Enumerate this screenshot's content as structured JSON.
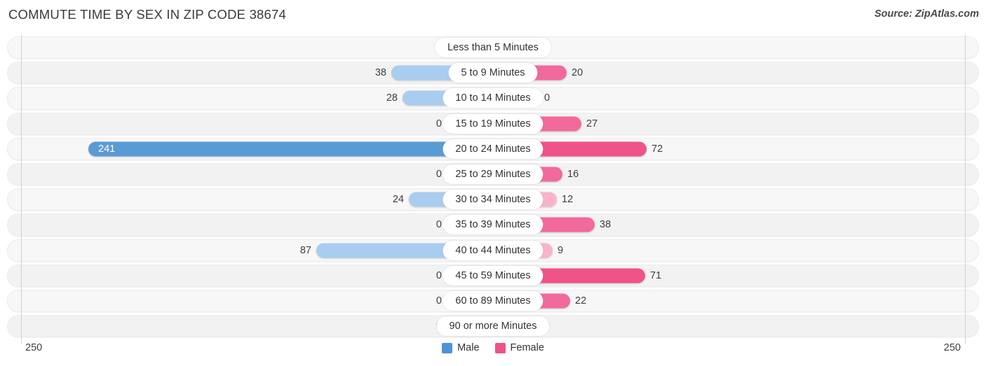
{
  "header": {
    "title": "COMMUTE TIME BY SEX IN ZIP CODE 38674",
    "source": "Source: ZipAtlas.com"
  },
  "legend": {
    "male_label": "Male",
    "female_label": "Female",
    "male_color": "#4d93db",
    "female_color": "#ef5389"
  },
  "axis": {
    "left_label": "250",
    "right_label": "250",
    "max": 250
  },
  "chart_data": {
    "type": "bar",
    "orientation": "horizontal-diverging",
    "title": "Commute Time by Sex in Zip Code 38674",
    "xlabel": "",
    "ylabel": "",
    "xlim": [
      250,
      250
    ],
    "grid": false,
    "legend_position": "bottom-center",
    "categories": [
      "Less than 5 Minutes",
      "5 to 9 Minutes",
      "10 to 14 Minutes",
      "15 to 19 Minutes",
      "20 to 24 Minutes",
      "25 to 29 Minutes",
      "30 to 34 Minutes",
      "35 to 39 Minutes",
      "40 to 44 Minutes",
      "45 to 59 Minutes",
      "60 to 89 Minutes",
      "90 or more Minutes"
    ],
    "series": [
      {
        "name": "Male",
        "color": "#5b9bd5",
        "values": [
          0,
          38,
          28,
          0,
          241,
          0,
          24,
          0,
          87,
          0,
          0,
          0
        ]
      },
      {
        "name": "Female",
        "color": "#ef5389",
        "values": [
          0,
          20,
          0,
          27,
          72,
          16,
          12,
          38,
          9,
          71,
          22,
          0
        ]
      }
    ]
  },
  "rows": [
    {
      "category": "Less than 5 Minutes",
      "male": "0",
      "female": "0",
      "male_w": 66,
      "female_w": 66,
      "male_tone": "lo",
      "female_tone": "lo",
      "male_inside": false
    },
    {
      "category": "5 to 9 Minutes",
      "male": "38",
      "female": "20",
      "male_w": 145,
      "female_w": 105,
      "male_tone": "lo",
      "female_tone": "hi",
      "male_inside": false
    },
    {
      "category": "10 to 14 Minutes",
      "male": "28",
      "female": "0",
      "male_w": 129,
      "female_w": 66,
      "male_tone": "lo",
      "female_tone": "lo",
      "male_inside": false
    },
    {
      "category": "15 to 19 Minutes",
      "male": "0",
      "female": "27",
      "male_w": 66,
      "female_w": 126,
      "male_tone": "lo",
      "female_tone": "hi",
      "male_inside": false
    },
    {
      "category": "20 to 24 Minutes",
      "male": "241",
      "female": "72",
      "male_w": 577,
      "female_w": 219,
      "male_tone": "hi",
      "female_tone": "hi2",
      "male_inside": true
    },
    {
      "category": "25 to 29 Minutes",
      "male": "0",
      "female": "16",
      "male_w": 66,
      "female_w": 99,
      "male_tone": "lo",
      "female_tone": "hi",
      "male_inside": false
    },
    {
      "category": "30 to 34 Minutes",
      "male": "24",
      "female": "12",
      "male_w": 120,
      "female_w": 91,
      "male_tone": "lo",
      "female_tone": "lo",
      "male_inside": false
    },
    {
      "category": "35 to 39 Minutes",
      "male": "0",
      "female": "38",
      "male_w": 66,
      "female_w": 145,
      "male_tone": "lo",
      "female_tone": "hi",
      "male_inside": false
    },
    {
      "category": "40 to 44 Minutes",
      "male": "87",
      "female": "9",
      "male_w": 252,
      "female_w": 85,
      "male_tone": "lo",
      "female_tone": "lo",
      "male_inside": false
    },
    {
      "category": "45 to 59 Minutes",
      "male": "0",
      "female": "71",
      "male_w": 66,
      "female_w": 217,
      "male_tone": "lo",
      "female_tone": "hi2",
      "male_inside": false
    },
    {
      "category": "60 to 89 Minutes",
      "male": "0",
      "female": "22",
      "male_w": 66,
      "female_w": 110,
      "male_tone": "lo",
      "female_tone": "hi",
      "male_inside": false
    },
    {
      "category": "90 or more Minutes",
      "male": "0",
      "female": "0",
      "male_w": 66,
      "female_w": 66,
      "male_tone": "lo",
      "female_tone": "lo",
      "male_inside": false
    }
  ]
}
